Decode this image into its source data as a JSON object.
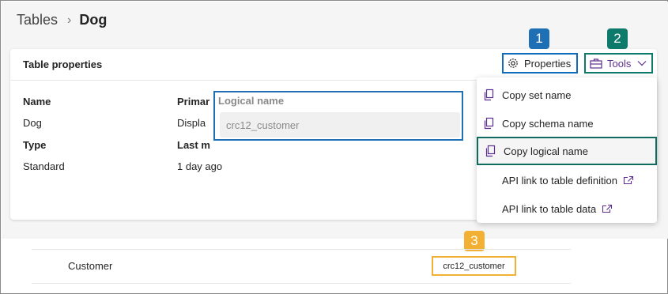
{
  "breadcrumb": {
    "root": "Tables",
    "separator": "›",
    "current": "Dog"
  },
  "card": {
    "title": "Table properties"
  },
  "toolbar": {
    "properties_label": "Properties",
    "tools_label": "Tools"
  },
  "fields": {
    "name_label": "Name",
    "name_value": "Dog",
    "type_label": "Type",
    "type_value": "Standard",
    "primary_label": "Primar",
    "display_value": "Displa",
    "last_modified_label": "Last m",
    "last_modified_value": "1 day ago"
  },
  "logical_name": {
    "label": "Logical name",
    "value": "crc12_customer"
  },
  "tools_menu": {
    "items": [
      {
        "label": "Copy set name",
        "icon": "copy-icon"
      },
      {
        "label": "Copy schema name",
        "icon": "copy-icon"
      },
      {
        "label": "Copy logical name",
        "icon": "copy-icon",
        "selected": true
      },
      {
        "label": "API link to table definition",
        "icon": "external-link-icon"
      },
      {
        "label": "API link to table data",
        "icon": "external-link-icon"
      }
    ]
  },
  "badges": {
    "one": "1",
    "two": "2",
    "three": "3"
  },
  "lower_row": {
    "label": "Customer",
    "value": "crc12_customer"
  },
  "colors": {
    "brand_purple": "#5c2e91",
    "blue_badge": "#1f6fb5",
    "green_badge": "#0e7a6c",
    "orange_badge": "#f2b134"
  }
}
